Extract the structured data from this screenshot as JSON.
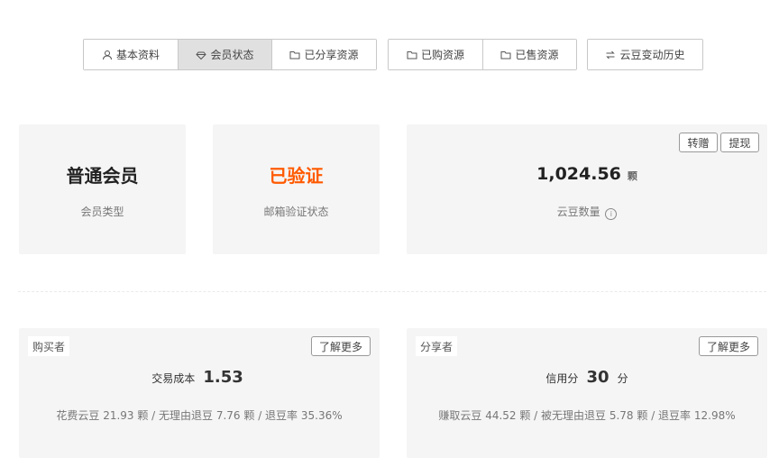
{
  "tabs_group1": [
    {
      "label": "基本资料",
      "icon": "user-icon",
      "active": false
    },
    {
      "label": "会员状态",
      "icon": "diamond-icon",
      "active": true
    },
    {
      "label": "已分享资源",
      "icon": "folder-icon",
      "active": false
    }
  ],
  "tabs_group2": [
    {
      "label": "已购资源",
      "icon": "folder-icon",
      "active": false
    },
    {
      "label": "已售资源",
      "icon": "folder-icon",
      "active": false
    }
  ],
  "tabs_group3": [
    {
      "label": "云豆变动历史",
      "icon": "swap-icon",
      "active": false
    }
  ],
  "member": {
    "value": "普通会员",
    "label": "会员类型"
  },
  "email": {
    "value": "已验证",
    "label": "邮箱验证状态",
    "color": "#ff5a00"
  },
  "beans": {
    "value": "1,024.56",
    "unit": "颗",
    "label": "云豆数量",
    "transfer_label": "转赠",
    "withdraw_label": "提现"
  },
  "buyer": {
    "tag": "购买者",
    "more_label": "了解更多",
    "metric_label": "交易成本",
    "metric_value": "1.53",
    "detail": "花费云豆 21.93 颗 / 无理由退豆 7.76 颗 / 退豆率 35.36%"
  },
  "sharer": {
    "tag": "分享者",
    "more_label": "了解更多",
    "metric_label": "信用分",
    "metric_value": "30",
    "metric_unit": "分",
    "detail": "赚取云豆 44.52 颗 / 被无理由退豆 5.78 颗 / 退豆率 12.98%"
  }
}
